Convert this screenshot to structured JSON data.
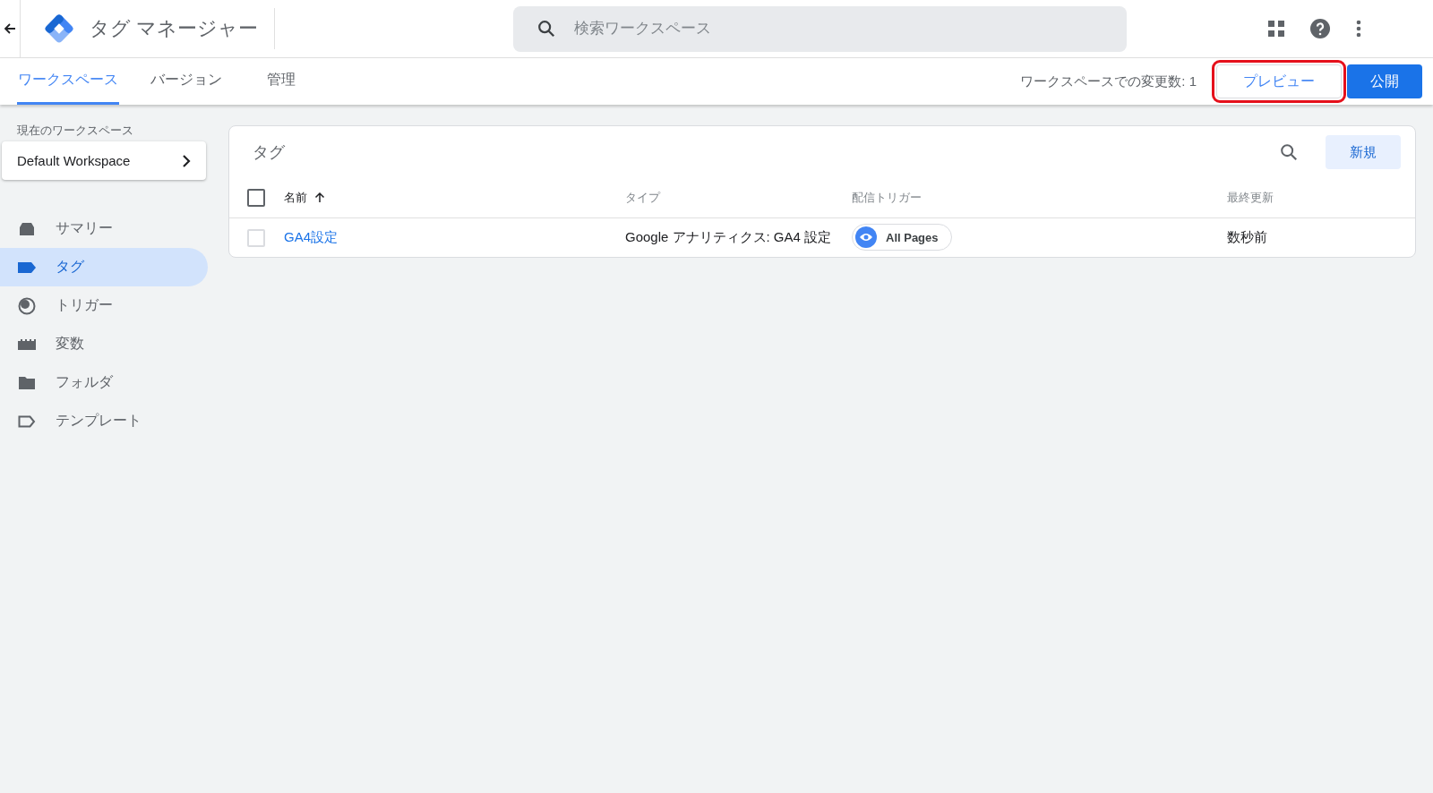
{
  "header": {
    "title": "タグ マネージャー",
    "search": {
      "placeholder": "検索ワークスペース"
    }
  },
  "tabs": [
    {
      "label": "ワークスペース",
      "selected": true
    },
    {
      "label": "バージョン",
      "selected": false
    },
    {
      "label": "管理",
      "selected": false
    }
  ],
  "changes": "ワークスペースでの変更数: 1",
  "buttons": [
    {
      "label": "プレビュー",
      "kind": "outline",
      "highlighted": true
    },
    {
      "label": "公開",
      "kind": "primary",
      "highlighted": false
    }
  ],
  "sidebar": {
    "workspace_label": "現在のワークスペース",
    "workspace": "Default Workspace",
    "items": [
      {
        "label": "サマリー",
        "kind": "summary",
        "selected": false
      },
      {
        "label": "タグ",
        "kind": "tag",
        "selected": true
      },
      {
        "label": "トリガー",
        "kind": "trigger",
        "selected": false
      },
      {
        "label": "変数",
        "kind": "variable",
        "selected": false
      },
      {
        "label": "フォルダ",
        "kind": "folder",
        "selected": false
      },
      {
        "label": "テンプレート",
        "kind": "template",
        "selected": false
      }
    ]
  },
  "table": {
    "title": "タグ",
    "new_button": "新規",
    "select_all_checked": false,
    "columns": [
      "名前",
      "タイプ",
      "配信トリガー",
      "最終更新"
    ],
    "rows": [
      {
        "name": "GA4設定",
        "type": "Google アナリティクス: GA4 設定",
        "trigger": "All Pages",
        "updated": "数秒前",
        "checked": false
      }
    ]
  }
}
